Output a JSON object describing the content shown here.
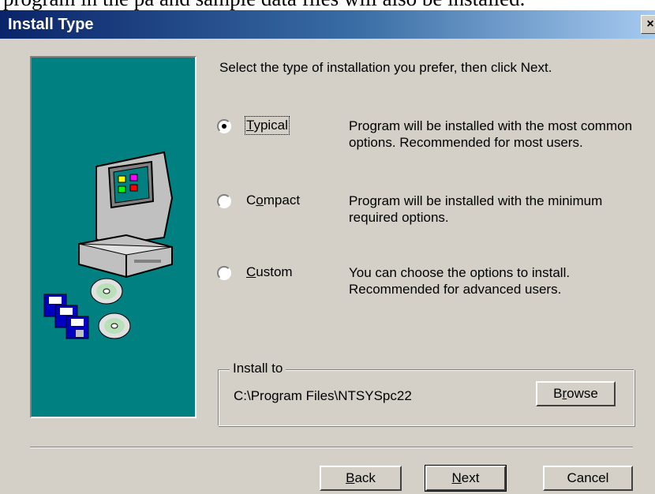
{
  "background_text": "program in the pa and sample data files will also be installed.",
  "window": {
    "title": "Install Type",
    "close_glyph": "×"
  },
  "prompt": "Select the type of installation you prefer, then click Next.",
  "options": [
    {
      "label_pre": "",
      "label_key": "T",
      "label_post": "ypical",
      "description": "Program will be installed with the most common options. Recommended for most users.",
      "selected": true
    },
    {
      "label_pre": "C",
      "label_key": "o",
      "label_post": "mpact",
      "description": "Program will be installed with the minimum required options.",
      "selected": false
    },
    {
      "label_pre": "",
      "label_key": "C",
      "label_post": "ustom",
      "description": "You can choose the options to install. Recommended for advanced users.",
      "selected": false
    }
  ],
  "install_to": {
    "group_label": "Install to",
    "path": "C:\\Program Files\\NTSYSpc22",
    "browse_pre": "B",
    "browse_key": "r",
    "browse_post": "owse"
  },
  "buttons": {
    "back_key": "B",
    "back_post": "ack",
    "next_key": "N",
    "next_post": "ext",
    "cancel": "Cancel"
  },
  "colors": {
    "panel": "#008080",
    "dialog": "#d4d0c8",
    "title_start": "#0a246a"
  },
  "icons": [
    "computer-icon",
    "floppy-disks-icon",
    "cd-disc-icon"
  ]
}
